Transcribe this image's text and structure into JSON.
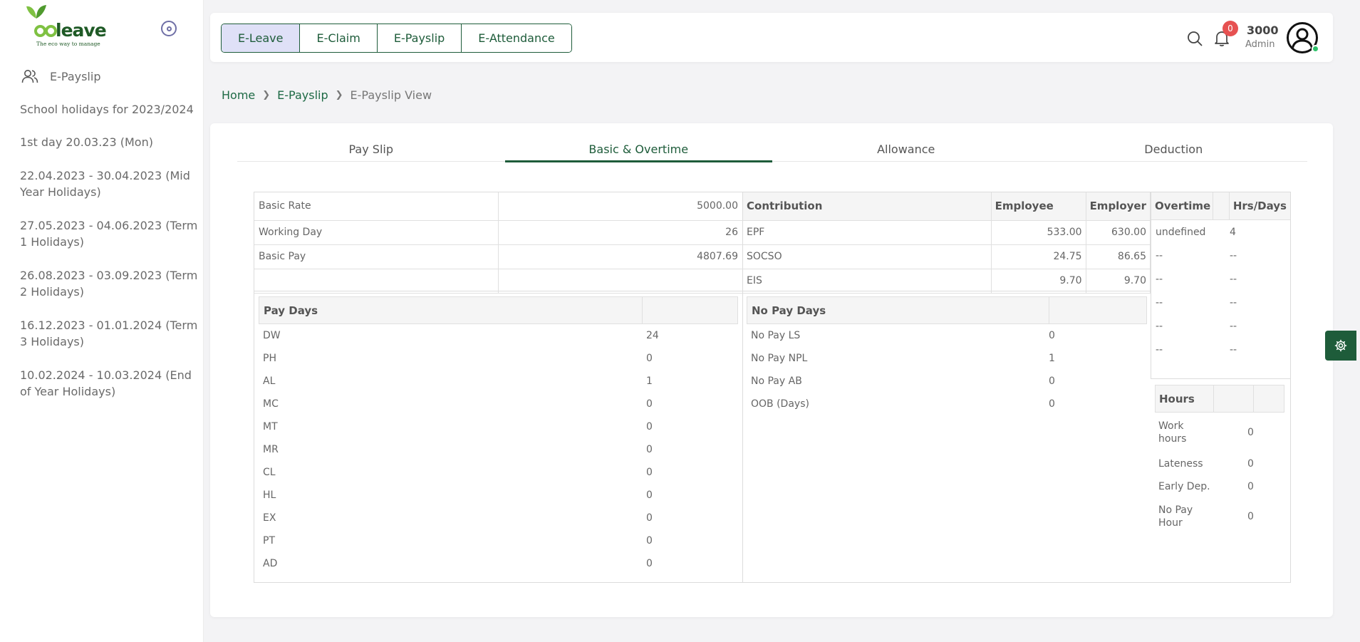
{
  "brand": {
    "logo_text": "leave",
    "logo_ring": "eco",
    "tagline": "The eco way to manage"
  },
  "sidebar": {
    "nav_label": "E-Payslip",
    "holidays": [
      "School holidays for 2023/2024",
      "1st day 20.03.23 (Mon)",
      "22.04.2023 - 30.04.2023 (Mid Year Holidays)",
      "27.05.2023 - 04.06.2023 (Term 1 Holidays)",
      "26.08.2023 - 03.09.2023 (Term 2 Holidays)",
      "16.12.2023 - 01.01.2024 (Term 3 Holidays)",
      "10.02.2024 - 10.03.2024 (End of Year Holidays)"
    ]
  },
  "topnav": {
    "tabs": [
      "E-Leave",
      "E-Claim",
      "E-Payslip",
      "E-Attendance"
    ],
    "active_tab": "E-Leave",
    "notification_count": "0",
    "user_name": "3000",
    "user_role": "Admin"
  },
  "breadcrumb": [
    "Home",
    "E-Payslip",
    "E-Payslip View"
  ],
  "subtabs": [
    "Pay Slip",
    "Basic & Overtime",
    "Allowance",
    "Deduction"
  ],
  "active_subtab": "Basic & Overtime",
  "basic": [
    {
      "label": "Basic Rate",
      "value": "5000.00"
    },
    {
      "label": "Working Day",
      "value": "26"
    },
    {
      "label": "Basic Pay",
      "value": "4807.69"
    },
    {
      "label": "",
      "value": ""
    }
  ],
  "contribution": {
    "headers": [
      "Contribution",
      "Employee",
      "Employer"
    ],
    "rows": [
      {
        "name": "EPF",
        "employee": "533.00",
        "employer": "630.00"
      },
      {
        "name": "SOCSO",
        "employee": "24.75",
        "employer": "86.65"
      },
      {
        "name": "EIS",
        "employee": "9.70",
        "employer": "9.70"
      }
    ]
  },
  "overtime": {
    "headers": [
      "Overtime",
      "",
      "Hrs/Days"
    ],
    "rows": [
      {
        "name": "undefined",
        "value": "4"
      },
      {
        "name": "--",
        "value": "--"
      },
      {
        "name": "--",
        "value": "--"
      },
      {
        "name": "--",
        "value": "--"
      },
      {
        "name": "--",
        "value": "--"
      },
      {
        "name": "--",
        "value": "--"
      }
    ]
  },
  "hours": {
    "header": "Hours",
    "rows": [
      {
        "name": "Work hours",
        "value": "0"
      },
      {
        "name": "Lateness",
        "value": "0"
      },
      {
        "name": "Early Dep.",
        "value": "0"
      },
      {
        "name": "No Pay Hour",
        "value": "0"
      }
    ]
  },
  "pay_days": {
    "header": "Pay Days",
    "rows": [
      {
        "name": "DW",
        "value": "24"
      },
      {
        "name": "PH",
        "value": "0"
      },
      {
        "name": "AL",
        "value": "1"
      },
      {
        "name": "MC",
        "value": "0"
      },
      {
        "name": "MT",
        "value": "0"
      },
      {
        "name": "MR",
        "value": "0"
      },
      {
        "name": "CL",
        "value": "0"
      },
      {
        "name": "HL",
        "value": "0"
      },
      {
        "name": "EX",
        "value": "0"
      },
      {
        "name": "PT",
        "value": "0"
      },
      {
        "name": "AD",
        "value": "0"
      }
    ]
  },
  "no_pay_days": {
    "header": "No Pay Days",
    "rows": [
      {
        "name": "No Pay LS",
        "value": "0"
      },
      {
        "name": "No Pay NPL",
        "value": "1"
      },
      {
        "name": "No Pay AB",
        "value": "0"
      },
      {
        "name": "OOB (Days)",
        "value": "0"
      }
    ]
  },
  "colors": {
    "primary": "#1e5c3a",
    "active_tab_bg": "#dfe0f7",
    "badge": "#e65151",
    "online": "#2fc26b"
  }
}
